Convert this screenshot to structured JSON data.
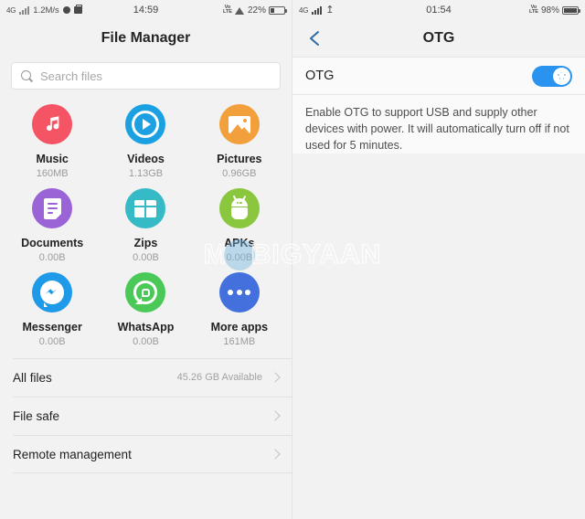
{
  "left": {
    "status": {
      "network": "4G",
      "speed": "1.2M/s",
      "time": "14:59",
      "volte": "VoLTE",
      "battery_percent": "22%"
    },
    "title": "File Manager",
    "search": {
      "placeholder": "Search files",
      "value": ""
    },
    "apps": [
      {
        "name": "Music",
        "size": "160MB",
        "icon": "music-icon",
        "color": "#f45464"
      },
      {
        "name": "Videos",
        "size": "1.13GB",
        "icon": "video-play-icon",
        "color": "#1ba1e2"
      },
      {
        "name": "Pictures",
        "size": "0.96GB",
        "icon": "picture-icon",
        "color": "#f2a03c"
      },
      {
        "name": "Documents",
        "size": "0.00B",
        "icon": "document-icon",
        "color": "#9a63d6"
      },
      {
        "name": "Zips",
        "size": "0.00B",
        "icon": "zip-icon",
        "color": "#35bac6"
      },
      {
        "name": "APKs",
        "size": "0.00B",
        "icon": "android-icon",
        "color": "#8bc63f"
      },
      {
        "name": "Messenger",
        "size": "0.00B",
        "icon": "messenger-icon",
        "color": "#1e9ae8"
      },
      {
        "name": "WhatsApp",
        "size": "0.00B",
        "icon": "whatsapp-icon",
        "color": "#4ac959"
      },
      {
        "name": "More apps",
        "size": "161MB",
        "icon": "more-apps-icon",
        "color": "#4470dd"
      }
    ],
    "rows": [
      {
        "label": "All files",
        "value": "45.26 GB  Available"
      },
      {
        "label": "File safe",
        "value": ""
      },
      {
        "label": "Remote management",
        "value": ""
      }
    ]
  },
  "right": {
    "status": {
      "network": "4G",
      "volte": "VoLTE",
      "battery_percent": "98%",
      "time": "01:54"
    },
    "title": "OTG",
    "back_icon": "back-chevron-icon",
    "otg": {
      "label": "OTG",
      "enabled": true,
      "description": "Enable OTG to support USB and supply other devices with power. It will automatically turn off if not used for 5 minutes."
    }
  },
  "watermark": {
    "text_a": "M",
    "text_b": "BIGYAAN"
  },
  "colors": {
    "accent_blue": "#2a93f0",
    "page_bg": "#f2f2f2",
    "card_bg": "#fafafa"
  }
}
